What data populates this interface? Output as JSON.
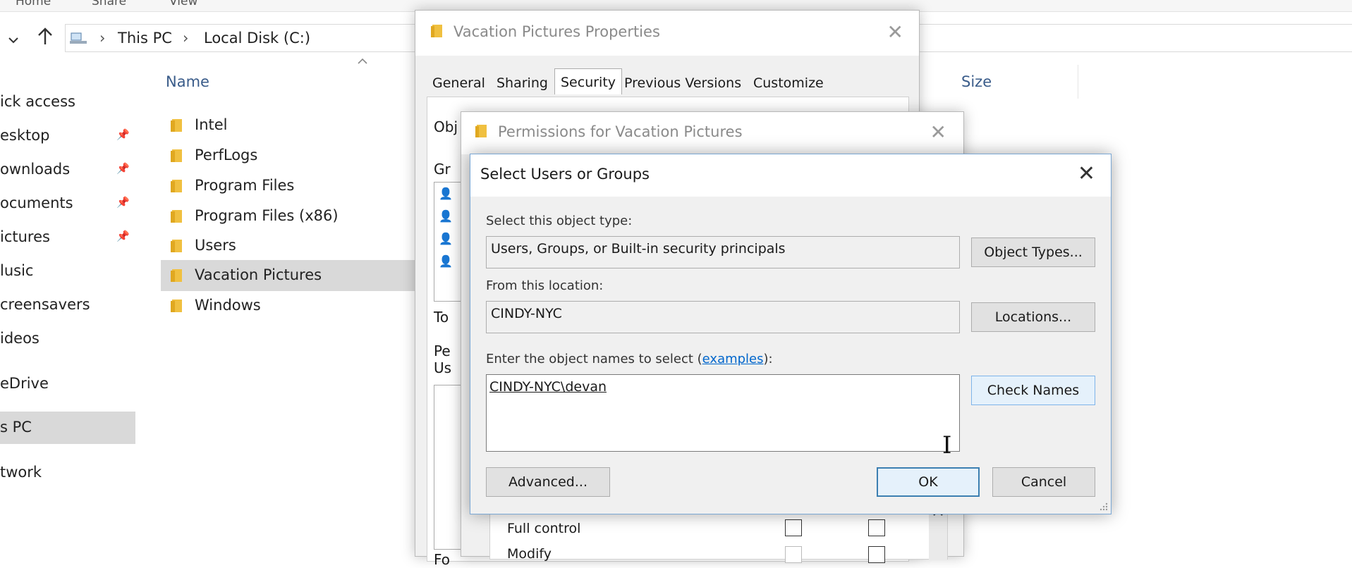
{
  "explorer": {
    "ribbon_tabs": [
      "Home",
      "Share",
      "View"
    ],
    "breadcrumb": [
      "This PC",
      "Local Disk (C:)"
    ],
    "sidebar": [
      {
        "label": "ick access"
      },
      {
        "label": "esktop",
        "pinned": true
      },
      {
        "label": "ownloads",
        "pinned": true
      },
      {
        "label": "ocuments",
        "pinned": true
      },
      {
        "label": "ictures",
        "pinned": true
      },
      {
        "label": "lusic"
      },
      {
        "label": "creensavers"
      },
      {
        "label": "ideos"
      },
      {
        "label": "eDrive"
      },
      {
        "label": "s PC",
        "selected": true
      },
      {
        "label": "twork"
      }
    ],
    "columns": {
      "name": "Name",
      "size": "Size"
    },
    "files": [
      {
        "name": "Intel"
      },
      {
        "name": "PerfLogs"
      },
      {
        "name": "Program Files"
      },
      {
        "name": "Program Files (x86)"
      },
      {
        "name": "Users"
      },
      {
        "name": "Vacation Pictures",
        "selected": true
      },
      {
        "name": "Windows"
      }
    ]
  },
  "properties_dialog": {
    "title": "Vacation Pictures Properties",
    "tabs": [
      "General",
      "Sharing",
      "Security",
      "Previous Versions",
      "Customize"
    ],
    "active_tab": "Security",
    "fragments": {
      "obj": "Obj",
      "gr": "Gr",
      "to": "To",
      "pe": "Pe",
      "us": "Us",
      "fo": "Fo"
    }
  },
  "permissions_dialog": {
    "title": "Permissions for Vacation Pictures",
    "permission_rows": [
      "Full control",
      "Modify"
    ]
  },
  "select_dialog": {
    "title": "Select Users or Groups",
    "object_type_label": "Select this object type:",
    "object_type_value": "Users, Groups, or Built-in security principals",
    "object_types_button": "Object Types...",
    "location_label": "From this location:",
    "location_value": "CINDY-NYC",
    "locations_button": "Locations...",
    "names_label_prefix": "Enter the object names to select (",
    "names_label_link": "examples",
    "names_label_suffix": "):",
    "names_value": "CINDY-NYC\\devan",
    "check_names_button": "Check Names",
    "advanced_button": "Advanced...",
    "ok_button": "OK",
    "cancel_button": "Cancel"
  },
  "colors": {
    "accent_link": "#0066cc",
    "focus_border": "#3c7fb1",
    "selection": "#d9d9d9",
    "folder": "#f0c040"
  }
}
